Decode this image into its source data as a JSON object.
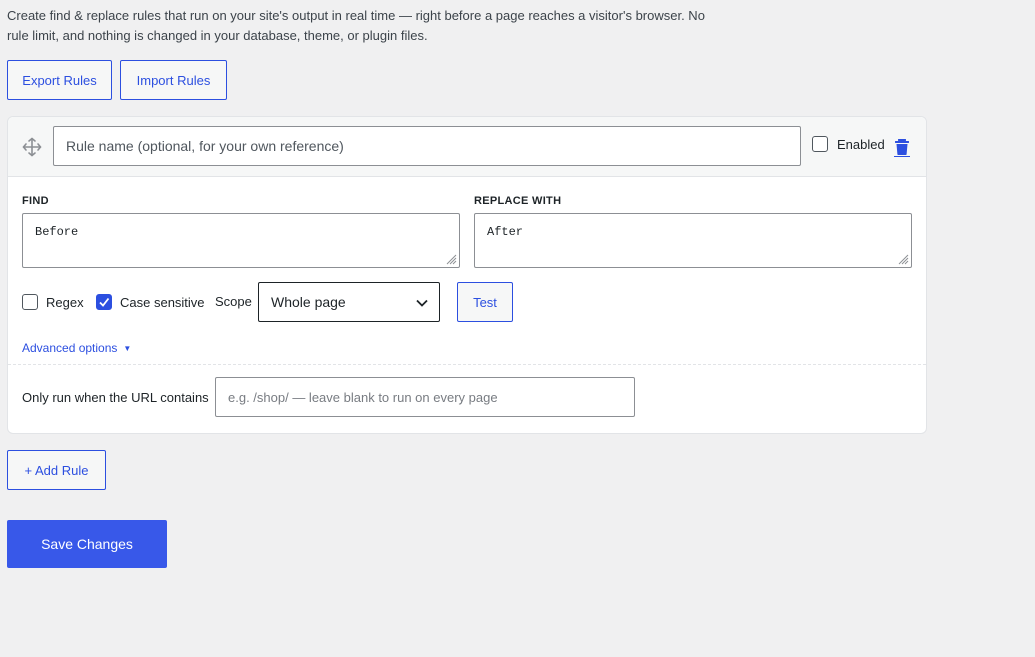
{
  "intro": {
    "description": "Create find & replace rules that run on your site's output in real time — right before a page reaches a visitor's browser. No rule limit, and nothing is changed in your database, theme, or plugin files."
  },
  "toolbar": {
    "export_label": "Export Rules",
    "import_label": "Import Rules"
  },
  "rule": {
    "name_placeholder": "Rule name (optional, for your own reference)",
    "name_value": "",
    "enabled_label": "Enabled",
    "enabled": false,
    "find_label": "FIND",
    "find_value": "Before",
    "replace_label": "REPLACE WITH",
    "replace_value": "After",
    "regex_label": "Regex",
    "regex": false,
    "case_label": "Case sensitive",
    "case_sensitive": true,
    "scope_label": "Scope",
    "scope_value": "Whole page",
    "test_label": "Test",
    "advanced_label": "Advanced options",
    "url_label": "Only run when the URL contains",
    "url_placeholder": "e.g. /shop/ — leave blank to run on every page",
    "url_value": ""
  },
  "actions": {
    "add_rule_label": "+ Add Rule",
    "save_label": "Save Changes"
  },
  "colors": {
    "accent": "#2c4fe0",
    "primary_button": "#3858e9",
    "background": "#f0f0f1"
  },
  "icons": {
    "drag": "move-icon",
    "delete": "trash-icon",
    "select": "chevron-down-icon",
    "advanced": "caret-down-icon"
  }
}
